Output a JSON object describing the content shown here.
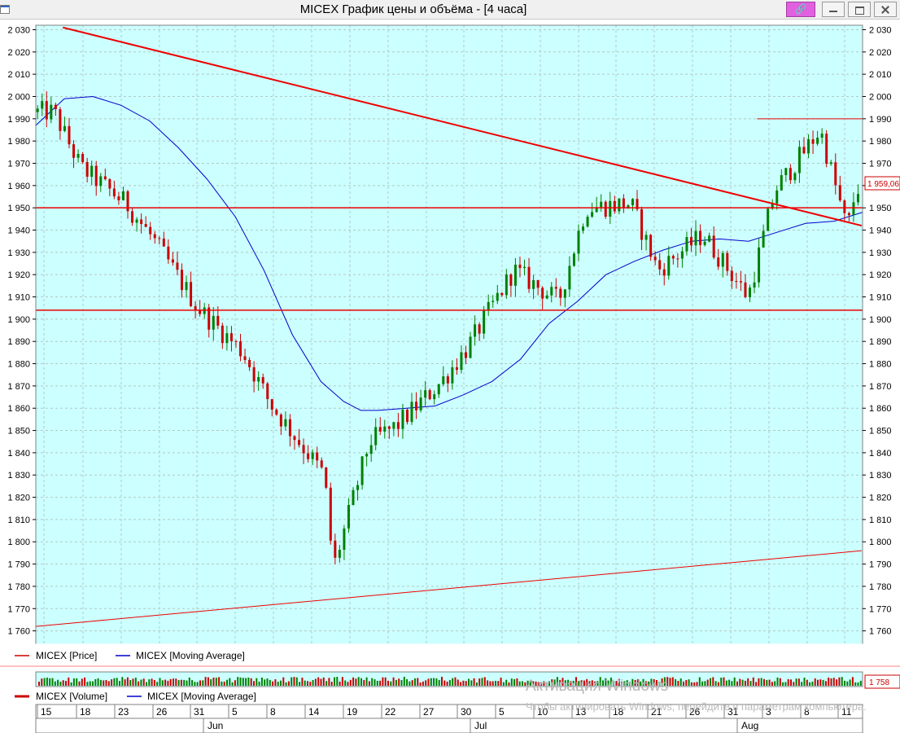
{
  "window": {
    "title": "MICEX График цены и объёма - [4 часа]",
    "buttons": [
      "pin",
      "minimize",
      "maximize",
      "close"
    ]
  },
  "price_legend": {
    "price": "MICEX [Price]",
    "ma": "MICEX [Moving Average]"
  },
  "volume_legend": {
    "volume": "MICEX [Volume]",
    "ma": "MICEX [Moving Average]"
  },
  "price_marker": "1 959,06",
  "volume_marker": "1 758",
  "x_axis": {
    "days": [
      {
        "label": "15",
        "x": 54
      },
      {
        "label": "18",
        "x": 102
      },
      {
        "label": "23",
        "x": 149
      },
      {
        "label": "26",
        "x": 196
      },
      {
        "label": "31",
        "x": 242
      },
      {
        "label": "5",
        "x": 289
      },
      {
        "label": "8",
        "x": 336
      },
      {
        "label": "14",
        "x": 383
      },
      {
        "label": "19",
        "x": 430
      },
      {
        "label": "22",
        "x": 477
      },
      {
        "label": "27",
        "x": 524
      },
      {
        "label": "30",
        "x": 570
      },
      {
        "label": "5",
        "x": 617
      },
      {
        "label": "10",
        "x": 664
      },
      {
        "label": "13",
        "x": 711
      },
      {
        "label": "18",
        "x": 757
      },
      {
        "label": "21",
        "x": 804
      },
      {
        "label": "26",
        "x": 851
      },
      {
        "label": "31",
        "x": 898
      },
      {
        "label": "3",
        "x": 945
      },
      {
        "label": "8",
        "x": 992
      },
      {
        "label": "11",
        "x": 1038
      }
    ],
    "months": [
      {
        "label": "Jun",
        "x": 258
      },
      {
        "label": "Jul",
        "x": 586
      },
      {
        "label": "Aug",
        "x": 914
      }
    ]
  },
  "watermark": {
    "line1": "Активация Windows",
    "line2": "Чтобы активировать Windows, перейдите в параметрам компьютера."
  },
  "colors": {
    "background": "#ccffff",
    "up": "#008000",
    "down": "#cc0000",
    "ma": "#0000cc",
    "trend": "#ee0000",
    "grid": "#b4c8c8"
  },
  "chart_data": {
    "type": "candlestick",
    "title": "MICEX График цены и объёма - [4 часа]",
    "timeframe": "4 часа",
    "x_range": [
      "May 13",
      "Aug 12"
    ],
    "y_range": [
      1754,
      2032
    ],
    "y_ticks": [
      2030,
      2020,
      2010,
      2000,
      1990,
      1980,
      1970,
      1960,
      1950,
      1940,
      1930,
      1920,
      1910,
      1900,
      1890,
      1880,
      1870,
      1860,
      1850,
      1840,
      1830,
      1820,
      1810,
      1800,
      1790,
      1780,
      1770,
      1760
    ],
    "tick_format": "space thousands",
    "grid": true,
    "legend": "bottom-left",
    "series": [
      {
        "name": "MICEX [Price]",
        "type": "candlestick",
        "color": "#cc0000"
      },
      {
        "name": "MICEX [Moving Average]",
        "type": "line",
        "color": "#0000cc"
      }
    ],
    "anchors": [
      {
        "date": "May 15",
        "close": 1993
      },
      {
        "date": "May 18",
        "close": 1968
      },
      {
        "date": "May 23",
        "close": 1952
      },
      {
        "date": "May 26",
        "close": 1936
      },
      {
        "date": "May 31",
        "close": 1905
      },
      {
        "date": "Jun 5",
        "close": 1885
      },
      {
        "date": "Jun 8",
        "close": 1862
      },
      {
        "date": "Jun 14",
        "close": 1830
      },
      {
        "date": "Jun 15",
        "close": 1788
      },
      {
        "date": "Jun 19",
        "close": 1845
      },
      {
        "date": "Jun 22",
        "close": 1852
      },
      {
        "date": "Jun 27",
        "close": 1872
      },
      {
        "date": "Jun 30",
        "close": 1888
      },
      {
        "date": "Jul 5",
        "close": 1922
      },
      {
        "date": "Jul 10",
        "close": 1908
      },
      {
        "date": "Jul 13",
        "close": 1950
      },
      {
        "date": "Jul 18",
        "close": 1952
      },
      {
        "date": "Jul 21",
        "close": 1922
      },
      {
        "date": "Jul 26",
        "close": 1938
      },
      {
        "date": "Jul 31",
        "close": 1910
      },
      {
        "date": "Aug 3",
        "close": 1958
      },
      {
        "date": "Aug 8",
        "close": 1985
      },
      {
        "date": "Aug 11",
        "close": 1940
      },
      {
        "date": "Aug 12",
        "close": 1959.06
      }
    ],
    "ma_points": [
      [
        2000,
        1987
      ],
      [
        2005,
        1999
      ],
      [
        2010,
        2000
      ],
      [
        2015,
        1996
      ],
      [
        2020,
        1989
      ],
      [
        2025,
        1977
      ],
      [
        2030,
        1963
      ],
      [
        2035,
        1946
      ],
      [
        2040,
        1922
      ],
      [
        2045,
        1893
      ],
      [
        2050,
        1872
      ],
      [
        2054,
        1863
      ],
      [
        2057,
        1859
      ],
      [
        2060,
        1859
      ],
      [
        2065,
        1860
      ],
      [
        2070,
        1861
      ],
      [
        2075,
        1866
      ],
      [
        2080,
        1872
      ],
      [
        2085,
        1882
      ],
      [
        2090,
        1898
      ],
      [
        2095,
        1908
      ],
      [
        2100,
        1920
      ],
      [
        2105,
        1926
      ],
      [
        2110,
        1931
      ],
      [
        2115,
        1935
      ],
      [
        2120,
        1936
      ],
      [
        2125,
        1935
      ],
      [
        2130,
        1939
      ],
      [
        2135,
        1943
      ],
      [
        2140,
        1944
      ],
      [
        2145,
        1948
      ]
    ],
    "horizontal_lines": [
      1950,
      1904
    ],
    "short_line": {
      "value": 1990,
      "from": "Aug 1",
      "to": "Aug 12"
    },
    "trend_lines": [
      {
        "from": [
          "May 16",
          2031
        ],
        "to": [
          "Aug 12",
          1942
        ]
      },
      {
        "from": [
          "May 13",
          1762
        ],
        "to": [
          "Aug 12",
          1796
        ]
      }
    ],
    "last_price": 1959.06,
    "volume_last": 1758
  }
}
